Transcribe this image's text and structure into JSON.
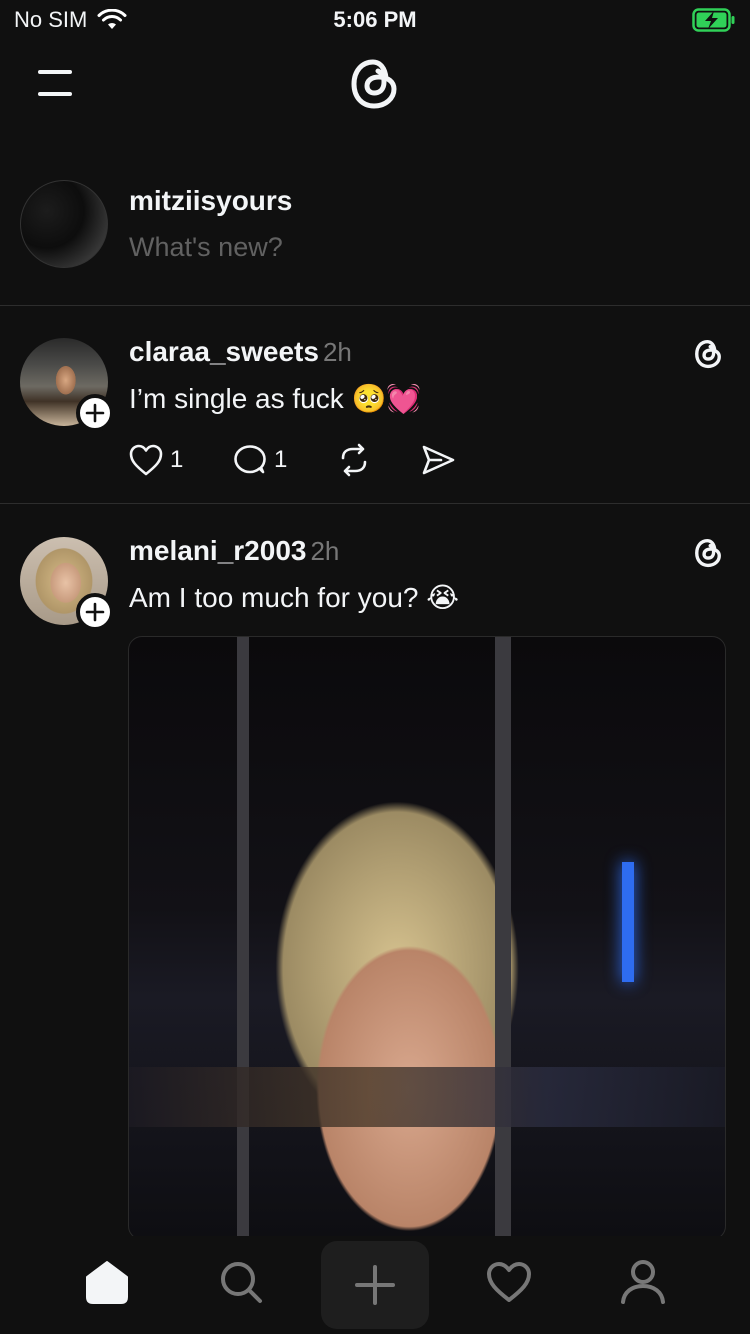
{
  "status_bar": {
    "carrier": "No SIM",
    "time": "5:06 PM",
    "battery_color": "#30d158"
  },
  "top_nav": {
    "menu_icon": "hamburger-icon",
    "logo_icon": "threads-logo-icon"
  },
  "composer": {
    "username": "mitziisyours",
    "placeholder": "What's new?"
  },
  "posts": [
    {
      "username": "claraa_sweets",
      "time": "2h",
      "text": "I’m single as fuck 🥺💓",
      "likes": "1",
      "replies": "1"
    },
    {
      "username": "melani_r2003",
      "time": "2h",
      "text": "Am I too much for you? 😭",
      "has_image": true
    }
  ],
  "tab_bar": {
    "items": [
      "home-icon",
      "search-icon",
      "new-post-icon",
      "heart-icon",
      "profile-icon"
    ],
    "active": "home-icon"
  }
}
